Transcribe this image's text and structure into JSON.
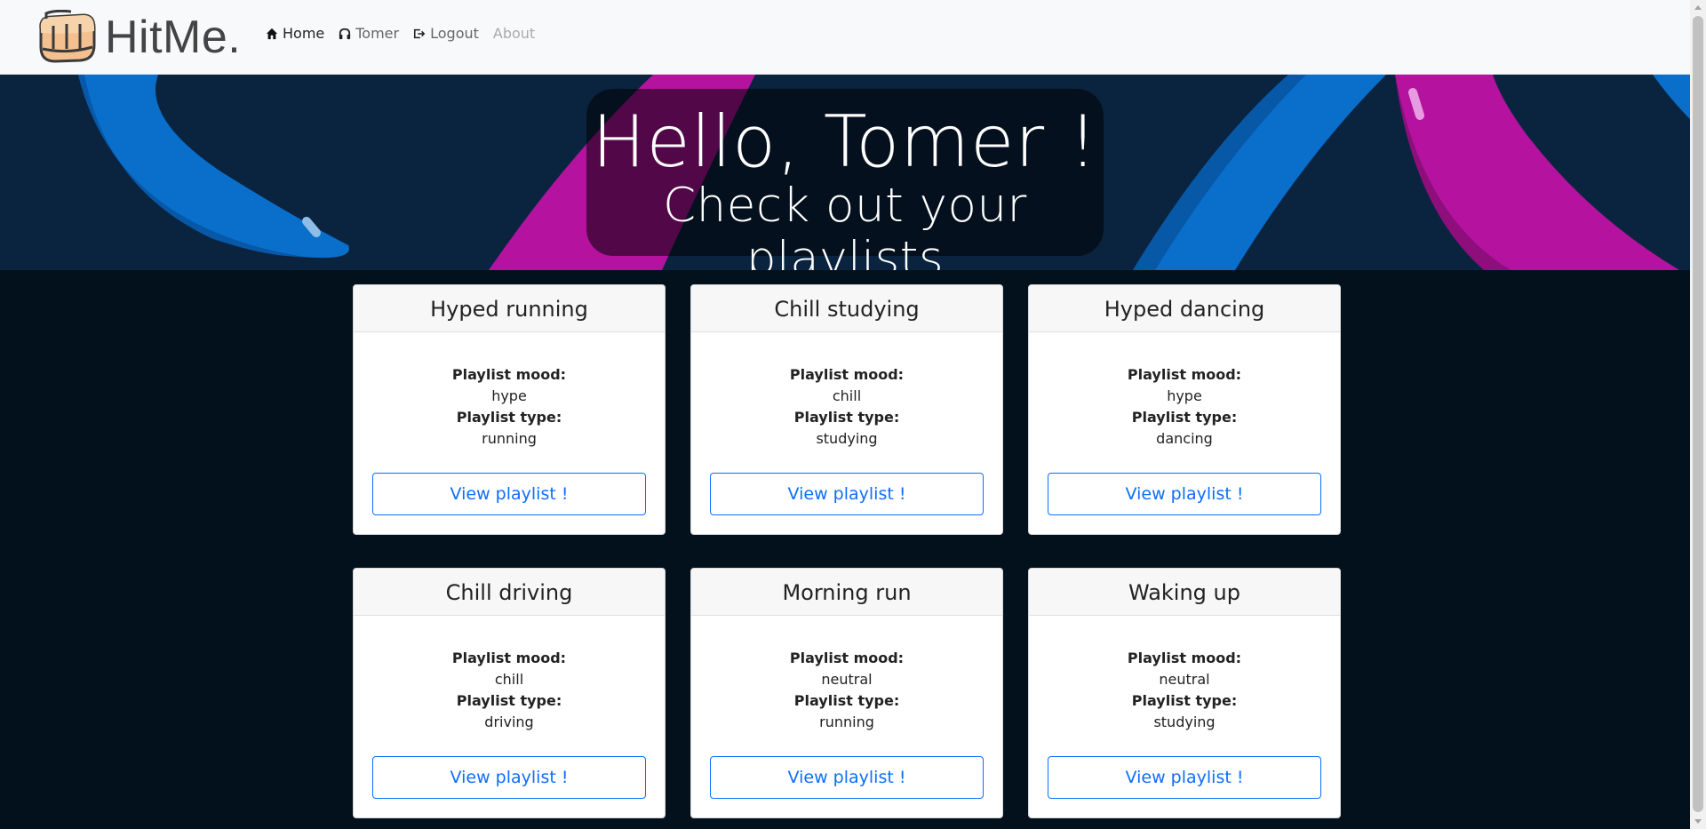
{
  "brand": {
    "name": "HitMe."
  },
  "nav": {
    "home": "Home",
    "user": "Tomer",
    "logout": "Logout",
    "about": "About"
  },
  "hero": {
    "title": "Hello, Tomer !",
    "subtitle": "Check out your playlists"
  },
  "labels": {
    "mood": "Playlist mood:",
    "type": "Playlist type:",
    "button": "View playlist !"
  },
  "playlists": [
    {
      "name": "Hyped running",
      "mood": "hype",
      "type": "running"
    },
    {
      "name": "Chill studying",
      "mood": "chill",
      "type": "studying"
    },
    {
      "name": "Hyped dancing",
      "mood": "hype",
      "type": "dancing"
    },
    {
      "name": "Chill driving",
      "mood": "chill",
      "type": "driving"
    },
    {
      "name": "Morning run",
      "mood": "neutral",
      "type": "running"
    },
    {
      "name": "Waking up",
      "mood": "neutral",
      "type": "studying"
    }
  ],
  "colors": {
    "accent": "#0d6efd",
    "hero_bg": "#0a2440",
    "page_bg": "#03111d",
    "magenta": "#b5139f",
    "blue": "#0a6ecb"
  },
  "icons": [
    "fist-logo",
    "home-icon",
    "headphones-icon",
    "logout-icon"
  ]
}
